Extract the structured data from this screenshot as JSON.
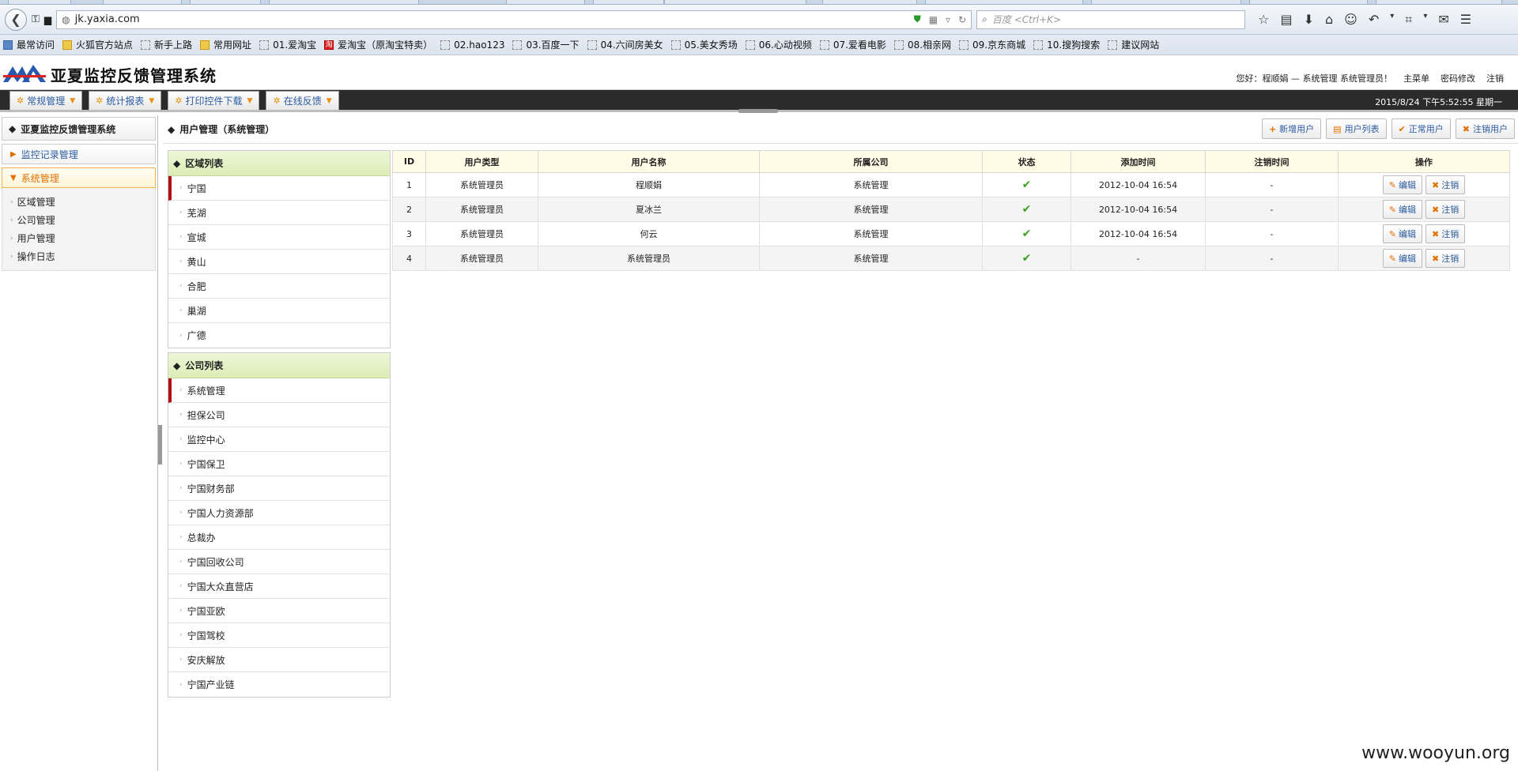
{
  "browser": {
    "url": "jk.yaxia.com",
    "search_placeholder": "百度 <Ctrl+K>",
    "bookmarks": [
      {
        "label": "最常访问",
        "icon": "blue"
      },
      {
        "label": "火狐官方站点",
        "icon": "folder"
      },
      {
        "label": "新手上路",
        "icon": "page"
      },
      {
        "label": "常用网址",
        "icon": "folder"
      },
      {
        "label": "01.爱淘宝",
        "icon": "page"
      },
      {
        "label": "爱淘宝（原淘宝特卖）",
        "icon": "red"
      },
      {
        "label": "02.hao123",
        "icon": "page"
      },
      {
        "label": "03.百度一下",
        "icon": "page"
      },
      {
        "label": "04.六间房美女",
        "icon": "page"
      },
      {
        "label": "05.美女秀场",
        "icon": "page"
      },
      {
        "label": "06.心动视频",
        "icon": "page"
      },
      {
        "label": "07.爱看电影",
        "icon": "page"
      },
      {
        "label": "08.相亲网",
        "icon": "page"
      },
      {
        "label": "09.京东商城",
        "icon": "page"
      },
      {
        "label": "10.搜狗搜索",
        "icon": "page"
      },
      {
        "label": "建议网站",
        "icon": "page"
      }
    ]
  },
  "app": {
    "title": "亚夏监控反馈管理系统",
    "greeting": "您好：程顺娟 — 系统管理 系统管理员！",
    "links": [
      "主菜单",
      "密码修改",
      "注销"
    ],
    "datetime": "2015/8/24 下午5:52:55 星期一",
    "menus": [
      "常规管理",
      "统计报表",
      "打印控件下载",
      "在线反馈"
    ]
  },
  "sidebar": {
    "title": "亚夏监控反馈管理系统",
    "groups": [
      {
        "label": "监控记录管理"
      },
      {
        "label": "系统管理"
      }
    ],
    "items": [
      "区域管理",
      "公司管理",
      "用户管理",
      "操作日志"
    ]
  },
  "main": {
    "title": "用户管理（系统管理）",
    "actions": [
      {
        "icon": "+",
        "label": "新增用户"
      },
      {
        "icon": "▤",
        "label": "用户列表"
      },
      {
        "icon": "✔",
        "label": "正常用户"
      },
      {
        "icon": "✖",
        "label": "注销用户"
      }
    ],
    "region_panel": {
      "title": "区域列表",
      "items": [
        "宁国",
        "芜湖",
        "宣城",
        "黄山",
        "合肥",
        "巢湖",
        "广德"
      ]
    },
    "company_panel": {
      "title": "公司列表",
      "items": [
        "系统管理",
        "担保公司",
        "监控中心",
        "宁国保卫",
        "宁国财务部",
        "宁国人力资源部",
        "总裁办",
        "宁国回收公司",
        "宁国大众直营店",
        "宁国亚欧",
        "宁国驾校",
        "安庆解放",
        "宁国产业链"
      ]
    },
    "table": {
      "columns": [
        "ID",
        "用户类型",
        "用户名称",
        "所属公司",
        "状态",
        "添加时间",
        "注销时间",
        "操作"
      ],
      "rows": [
        {
          "id": "1",
          "type": "系统管理员",
          "name": "程顺娟",
          "company": "系统管理",
          "status": "✔",
          "added": "2012-10-04 16:54",
          "cancelled": "-"
        },
        {
          "id": "2",
          "type": "系统管理员",
          "name": "夏冰兰",
          "company": "系统管理",
          "status": "✔",
          "added": "2012-10-04 16:54",
          "cancelled": "-"
        },
        {
          "id": "3",
          "type": "系统管理员",
          "name": "何云",
          "company": "系统管理",
          "status": "✔",
          "added": "2012-10-04 16:54",
          "cancelled": "-"
        },
        {
          "id": "4",
          "type": "系统管理员",
          "name": "系统管理员",
          "company": "系统管理",
          "status": "✔",
          "added": "-",
          "cancelled": "-"
        }
      ],
      "edit_label": "编辑",
      "cancel_label": "注销"
    }
  },
  "watermark": "www.wooyun.org"
}
